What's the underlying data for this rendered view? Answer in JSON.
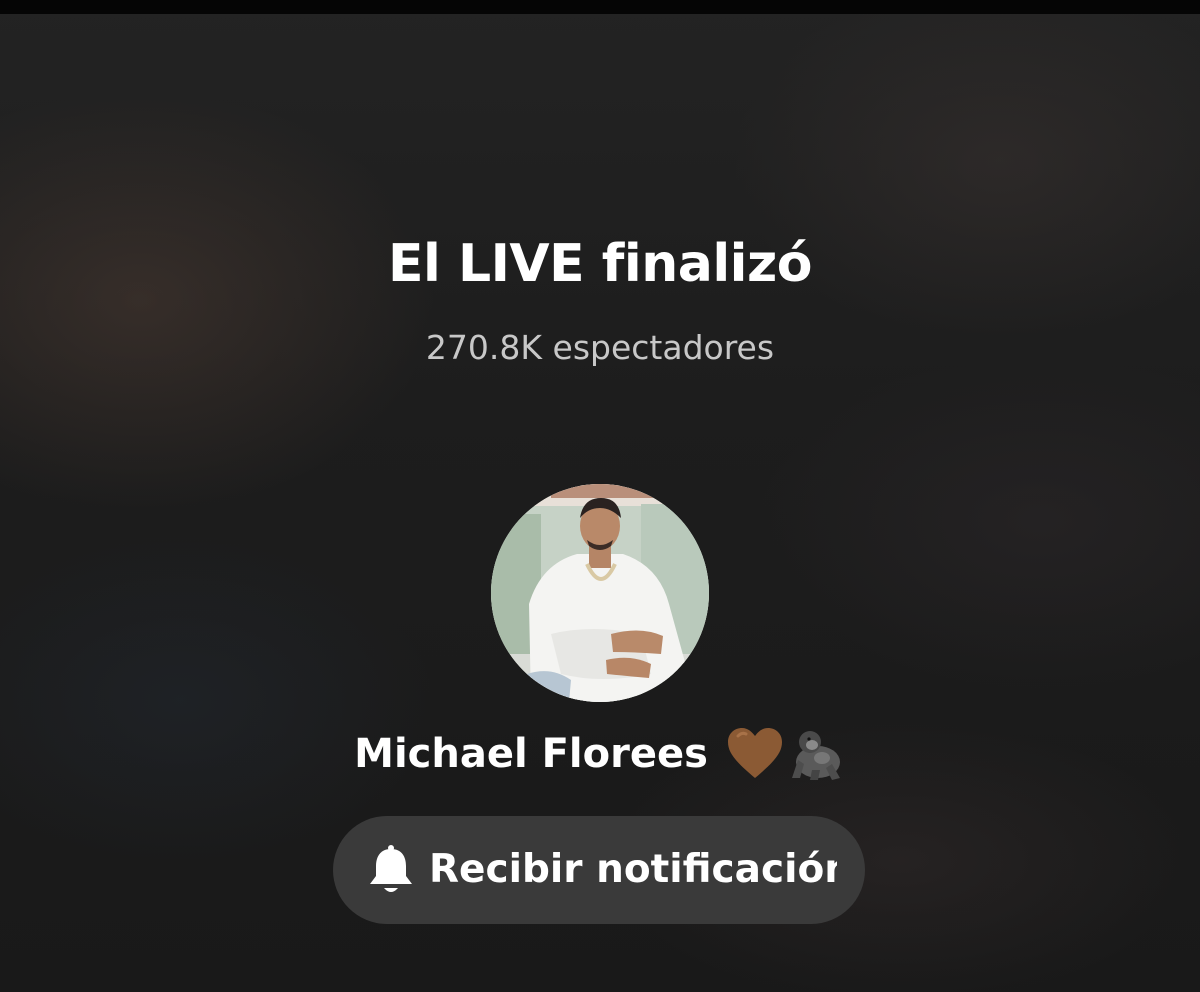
{
  "live_ended": {
    "title": "El LIVE finalizó",
    "viewers": "270.8K espectadores"
  },
  "host": {
    "name": "Michael Florees",
    "emoji_icons": [
      "brown-heart-icon",
      "gorilla-icon"
    ],
    "emoji_colors": {
      "heart": "#8b5a34",
      "gorilla": "#6e6e6e"
    }
  },
  "notify_button": {
    "label": "Recibir notificación",
    "icon": "bell-icon",
    "background": "#3a3a3a"
  }
}
